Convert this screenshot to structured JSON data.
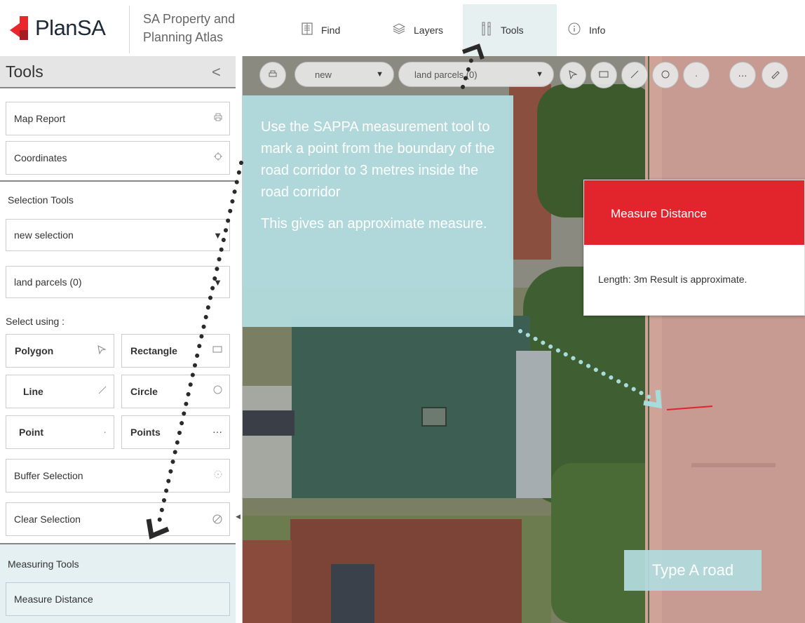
{
  "header": {
    "logo_text": "PlanSA",
    "atlas_title_line1": "SA Property and",
    "atlas_title_line2": "Planning Atlas",
    "nav": [
      {
        "label": "Find",
        "icon": "document-icon"
      },
      {
        "label": "Layers",
        "icon": "layers-icon"
      },
      {
        "label": "Tools",
        "icon": "tools-icon",
        "active": true
      },
      {
        "label": "Info",
        "icon": "info-icon"
      }
    ]
  },
  "sidebar": {
    "title": "Tools",
    "collapse_glyph": "<",
    "map_report": "Map Report",
    "coordinates": "Coordinates",
    "selection_tools_heading": "Selection Tools",
    "selection_mode": "new selection",
    "selection_layer": "land parcels (0)",
    "select_using_label": "Select using :",
    "shape_buttons": [
      {
        "label": "Polygon",
        "icon": "polygon-icon"
      },
      {
        "label": "Rectangle",
        "icon": "rectangle-icon"
      },
      {
        "label": "Line",
        "icon": "line-icon"
      },
      {
        "label": "Circle",
        "icon": "circle-icon"
      },
      {
        "label": "Point",
        "icon": "point-icon"
      },
      {
        "label": "Points",
        "icon": "points-icon"
      }
    ],
    "buffer_selection": "Buffer Selection",
    "clear_selection": "Clear Selection",
    "measuring_tools_heading": "Measuring Tools",
    "measure_distance": "Measure Distance"
  },
  "map_toolbar": {
    "mode_value": "new",
    "layer_value": "land parcels (0)"
  },
  "callout": {
    "paragraph1": "Use the SAPPA measurement tool to mark a point from the boundary of the road corridor to 3 metres inside the road corridor",
    "paragraph2": "This gives an approximate measure."
  },
  "measure_popup": {
    "title": "Measure Distance",
    "result": "Length: 3m Result is approximate."
  },
  "road_label": "Type A road",
  "colors": {
    "brand_red": "#e2252c",
    "callout_teal": "#b2dcde",
    "active_tab_bg": "#e6f0f1",
    "road_pink": "#c79a92"
  }
}
